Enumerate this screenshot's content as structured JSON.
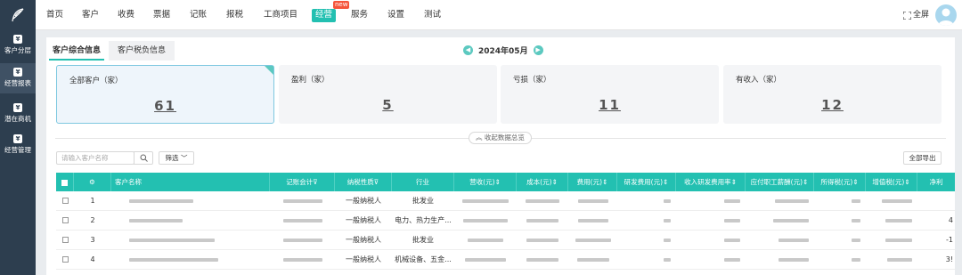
{
  "nav": {
    "items": [
      "首页",
      "客户",
      "收费",
      "票据",
      "记账",
      "报税",
      "工商项目",
      "经营",
      "服务",
      "设置",
      "测试"
    ],
    "active": "经营",
    "new_badge": "new",
    "fullscreen": "全屏"
  },
  "sidebar": {
    "items": [
      "客户分层",
      "经营报表",
      "潜在商机",
      "经营管理"
    ],
    "active": "经营报表"
  },
  "tabs": [
    "客户综合信息",
    "客户税负信息"
  ],
  "month": "2024年05月",
  "cards": [
    {
      "title": "全部客户（家）",
      "value": "61",
      "selected": true
    },
    {
      "title": "盈利（家）",
      "value": "5",
      "selected": false
    },
    {
      "title": "亏损（家）",
      "value": "11",
      "selected": false
    },
    {
      "title": "有收入（家）",
      "value": "12",
      "selected": false
    }
  ],
  "collapse_label": "收起数据总览",
  "search_placeholder": "请输入客户名称",
  "filter_label": "筛选",
  "export_label": "全部导出",
  "table": {
    "headers": [
      "",
      "",
      "客户名称",
      "记账会计",
      "纳税性质",
      "行业",
      "营收(元)",
      "成本(元)",
      "费用(元)",
      "研发费用(元)",
      "收入研发费用率",
      "应付职工薪酬(元)",
      "所得税(元)",
      "增值税(元)",
      "净利"
    ],
    "rows": [
      {
        "index": "1",
        "taxpayer": "一般纳税人",
        "industry": "批发业",
        "net": ""
      },
      {
        "index": "2",
        "taxpayer": "一般纳税人",
        "industry": "电力、热力生产...",
        "net": "4"
      },
      {
        "index": "3",
        "taxpayer": "一般纳税人",
        "industry": "批发业",
        "net": "-1"
      },
      {
        "index": "4",
        "taxpayer": "一般纳税人",
        "industry": "机械设备、五金...",
        "net": "3!"
      }
    ]
  },
  "colors": {
    "accent": "#23c0b1",
    "sidebar": "#2d3e4f",
    "badge": "#f5543a"
  }
}
